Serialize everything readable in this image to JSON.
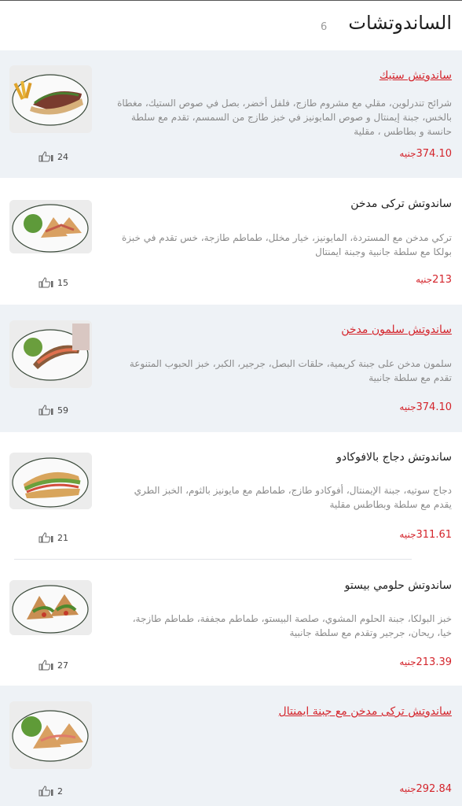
{
  "header": {
    "title": "الساندوتشات",
    "count": "6"
  },
  "currency": "جنيه",
  "items": [
    {
      "name": "ساندوتش ستيك",
      "featured": true,
      "desc": [
        "شرائح تندرلوين، مقلي مع مشروم طازج، فلفل أخضر، بصل في صوص الستيك، مغطاة",
        "بالخس، جبنة إيمنتال و صوص المايونيز في خبز طازج من السمسم، تقدم مع سلطة",
        "حانسة و بطاطس ، مقلية"
      ],
      "price": "374.10",
      "likes": "24",
      "image": "steak-sandwich-with-fries"
    },
    {
      "name": "ساندوتش تركى مدخن",
      "featured": false,
      "desc": [
        "تركي مدخن مع المستردة، المايونيز، خيار مخلل، طماطم طازجة، خس تقدم في خبزة",
        "بولكا مع سلطة جانبية وجبنة ايمنتال"
      ],
      "price": "213",
      "likes": "15",
      "image": "smoked-turkey-sandwich"
    },
    {
      "name": "ساندوتش سلمون مدخن",
      "featured": true,
      "desc": [
        "سلمون مدخن على جبنة كريمية، حلقات البصل، جرجير، الكبر، خبز الحبوب المتنوعة",
        "تقدم مع سلطة جانبية"
      ],
      "price": "374.10",
      "likes": "59",
      "image": "smoked-salmon-sandwich"
    },
    {
      "name": "ساندوتش دجاج بالافوكادو",
      "featured": false,
      "desc": [
        "دجاج سوتيه، جبنة الإيمنتال، أفوكادو طازج، طماطم مع مايونيز بالثوم، الخبز الطري",
        "يقدم مع سلطة وبطاطس مقلية"
      ],
      "price": "311.61",
      "likes": "21",
      "image": "chicken-avocado-sandwich"
    },
    {
      "name": "ساندوتش حلومي بيستو",
      "featured": false,
      "desc": [
        "خبز البولكا، جبنة الحلوم المشوي، صلصة البيستو، طماطم مجففة، طماطم طازجة،",
        "خيا، ريحان، جرجير وتقدم مع سلطة جانبية"
      ],
      "price": "213.39",
      "likes": "27",
      "image": "halloumi-pesto-sandwich"
    },
    {
      "name": "ساندوتش تركى مدخن مع جبنة ايمنتال",
      "featured": true,
      "desc": [],
      "price": "292.84",
      "likes": "2",
      "image": "turkey-emmental-sandwich"
    }
  ]
}
